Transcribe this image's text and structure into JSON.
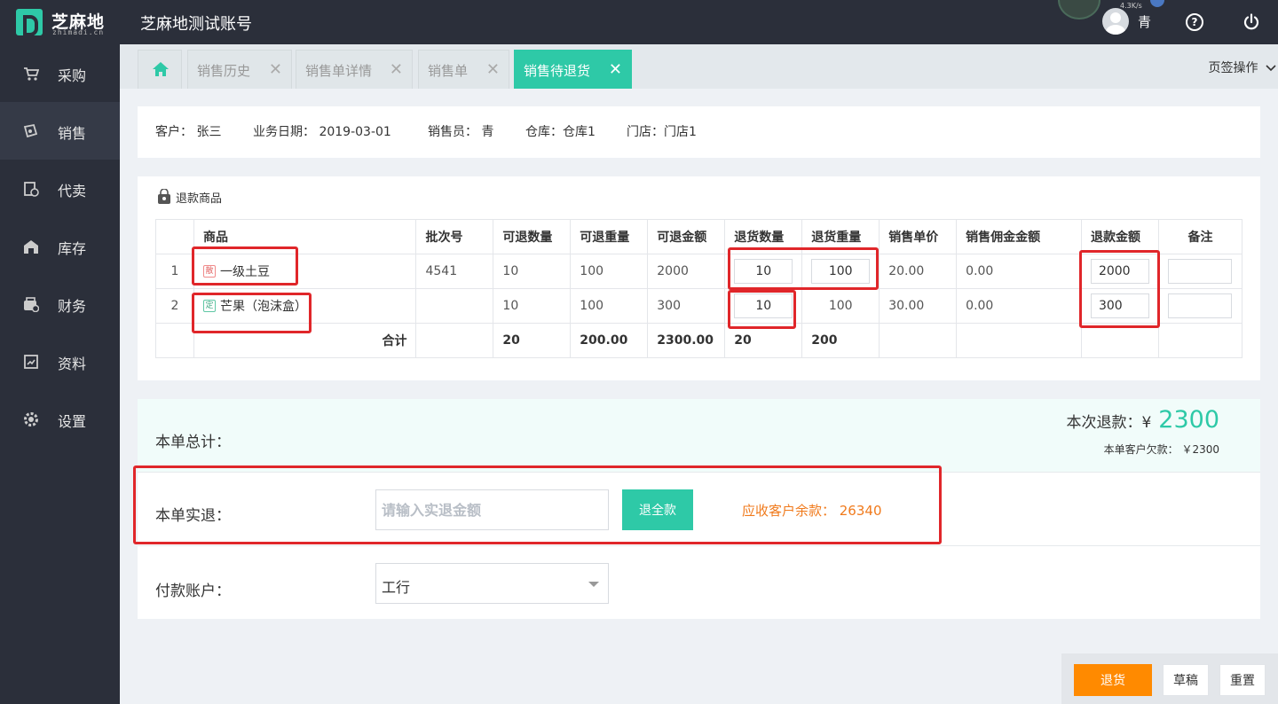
{
  "header": {
    "logo_text": "芝麻地",
    "logo_sub": "zhimadi.cn",
    "account_title": "芝麻地测试账号",
    "net_speed": "4.3K/s",
    "user_name": "青",
    "help_glyph": "?"
  },
  "sidebar": {
    "items": [
      {
        "label": "采购",
        "icon": "cart-icon"
      },
      {
        "label": "销售",
        "icon": "sale-icon"
      },
      {
        "label": "代卖",
        "icon": "consign-icon"
      },
      {
        "label": "库存",
        "icon": "warehouse-icon"
      },
      {
        "label": "财务",
        "icon": "finance-icon"
      },
      {
        "label": "资料",
        "icon": "profile-icon"
      },
      {
        "label": "设置",
        "icon": "gear-icon"
      }
    ]
  },
  "tabs": {
    "items": [
      {
        "label": "销售历史"
      },
      {
        "label": "销售单详情"
      },
      {
        "label": "销售单"
      },
      {
        "label": "销售待退货"
      }
    ],
    "close_glyph": "✕",
    "ops_label": "页签操作"
  },
  "info": {
    "customer": "客户： 张三",
    "date": "业务日期： 2019-03-01",
    "salesperson": "销售员： 青",
    "warehouse": "仓库：仓库1",
    "store": "门店：门店1"
  },
  "goods": {
    "title": "退款商品",
    "columns": [
      "商品",
      "批次号",
      "可退数量",
      "可退重量",
      "可退金额",
      "退货数量",
      "退货重量",
      "销售单价",
      "销售佣金金额",
      "退款金额",
      "备注"
    ],
    "rows": [
      {
        "index": "1",
        "badge": "散",
        "name": "一级土豆",
        "batch": "4541",
        "avail_qty": "10",
        "avail_weight": "100",
        "avail_amount": "2000",
        "ret_qty": "10",
        "ret_weight": "100",
        "unit_price": "20.00",
        "commission": "0.00",
        "refund": "2000",
        "remark": ""
      },
      {
        "index": "2",
        "badge": "定",
        "name": "芒果（泡沫盒）",
        "batch": "",
        "avail_qty": "10",
        "avail_weight": "100",
        "avail_amount": "300",
        "ret_qty": "10",
        "ret_weight": "100",
        "unit_price": "30.00",
        "commission": "0.00",
        "refund": "300",
        "remark": ""
      }
    ],
    "total": {
      "label": "合计",
      "avail_qty": "20",
      "avail_weight": "200.00",
      "avail_amount": "2300.00",
      "ret_qty": "20",
      "ret_weight": "200"
    }
  },
  "summary": {
    "label": "本单总计：",
    "refund_label": "本次退款：¥",
    "refund_amount": "2300",
    "owed": "本单客户欠款： ￥2300"
  },
  "actual": {
    "label": "本单实退：",
    "placeholder": "请输入实退金额",
    "full_button": "退全款",
    "receivable": "应收客户余款： 26340"
  },
  "payment": {
    "label": "付款账户：",
    "selected": "工行"
  },
  "actions": {
    "return_label": "退货",
    "draft_label": "草稿",
    "reset_label": "重置"
  },
  "colors": {
    "accent": "#2ec9a7",
    "sidebar_bg": "#2b2f3a",
    "warning": "#f07a1c",
    "primary_action": "#ff8a00",
    "highlight_box": "#e0262a"
  }
}
